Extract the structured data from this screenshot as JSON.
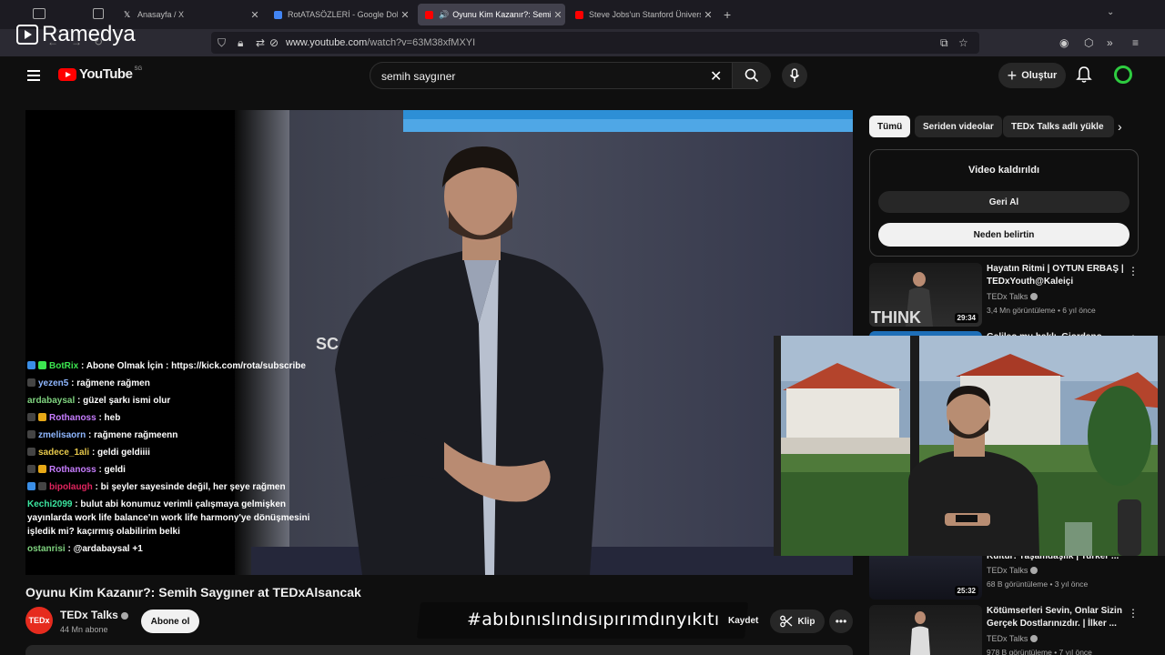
{
  "browser": {
    "tabs": [
      {
        "title": "Anasayfa / X",
        "favicon_color": "#ffffff"
      },
      {
        "title": "RotATASÖZLERİ - Google Doküm",
        "favicon_color": "#4285f4"
      },
      {
        "title": "Oyunu Kim Kazanır?: Semih",
        "favicon_color": "#ff0000"
      },
      {
        "title": "Steve Jobs'un Stanford Üniversi",
        "favicon_color": "#ff0000"
      }
    ],
    "url_domain": "www.youtube.com",
    "url_path": "/watch?v=63M38xfMXYI"
  },
  "stream_logo": "Ramedya",
  "youtube": {
    "logo_text": "YouTube",
    "country_code": "SG",
    "search_value": "semih saygıner",
    "create_label": "Oluştur",
    "accent": "#ff0000"
  },
  "video": {
    "title": "Oyunu Kim Kazanır?: Semih Saygıner at TEDxAlsancak",
    "channel": "TEDx Talks",
    "channel_logo": "TEDx",
    "subscribers": "44 Mn abone",
    "subscribe_label": "Abone ol",
    "stage_text": "SC",
    "save_label": "Kaydet",
    "clip_label": "Klip",
    "overlay_hashtag": "#abıbınıslındısıpırımdınyıkıtı"
  },
  "chat": [
    {
      "user": "BotRix",
      "color": "#3ce650",
      "msg": "Abone Olmak İçin : https://kick.com/rota/subscribe",
      "badges": [
        "#3a8ee6",
        "#3ce650"
      ]
    },
    {
      "user": "yezen5",
      "color": "#8fb7ff",
      "msg": "rağmene rağmen",
      "badges": [
        "#444444"
      ]
    },
    {
      "user": "ardabaysal",
      "color": "#7fd37f",
      "msg": "güzel şarkı ismi olur",
      "badges": []
    },
    {
      "user": "Rothanoss",
      "color": "#c77dff",
      "msg": "heb",
      "badges": [
        "#444444",
        "#e6a817"
      ]
    },
    {
      "user": "zmelisaorn",
      "color": "#8fb7ff",
      "msg": "rağmene rağmeenn",
      "badges": [
        "#444444"
      ]
    },
    {
      "user": "sadece_1ali",
      "color": "#e6c84b",
      "msg": "geldi geldiiii",
      "badges": [
        "#444444"
      ]
    },
    {
      "user": "Rothanoss",
      "color": "#c77dff",
      "msg": "geldi",
      "badges": [
        "#444444",
        "#e6a817"
      ]
    },
    {
      "user": "bipolaugh",
      "color": "#e0245e",
      "msg": "bi şeyler sayesinde değil, her şeye rağmen",
      "badges": [
        "#3a8ee6",
        "#444444"
      ]
    },
    {
      "user": "Kechi2099",
      "color": "#3ce6a0",
      "msg": "bulut abi konumuz verimli çalışmaya gelmişken yayınlarda work life balance'ın work life harmony'ye dönüşmesini işledik mi? kaçırmış olabilirim belki",
      "badges": []
    },
    {
      "user": "ostanrisi",
      "color": "#7fd37f",
      "msg": "@ardabaysal +1",
      "badges": []
    }
  ],
  "sidebar": {
    "chips": [
      "Tümü",
      "Seriden videolar",
      "TEDx Talks adlı yükle"
    ],
    "removed_title": "Video kaldırıldı",
    "undo_label": "Geri Al",
    "why_label": "Neden belirtin",
    "recs": [
      {
        "title": "Hayatın Ritmi | OYTUN ERBAŞ | TEDxYouth@Kaleiçi",
        "channel": "TEDx Talks",
        "meta": "3,4 Mn görüntüleme • 6 yıl önce",
        "duration": "29:34",
        "thumb_color": "#2a2a2a"
      },
      {
        "title": "Galileo mu haklı, Giordano",
        "channel": "",
        "meta": "",
        "duration": "",
        "thumb_color": "#1e6fb8"
      },
      {
        "title": "Kültür: Yaşamdaşlık | Turker ...",
        "channel": "TEDx Talks",
        "meta": "68 B görüntüleme • 3 yıl önce",
        "duration": "25:32",
        "thumb_color": "#1a1a2a"
      },
      {
        "title": "Kötümserleri Sevin, Onlar Sizin Gerçek Dostlarınızdır. | İlker ...",
        "channel": "TEDx Talks",
        "meta": "978 B görüntüleme • 7 yıl önce",
        "duration": "",
        "thumb_color": "#2a2a2a"
      }
    ]
  }
}
